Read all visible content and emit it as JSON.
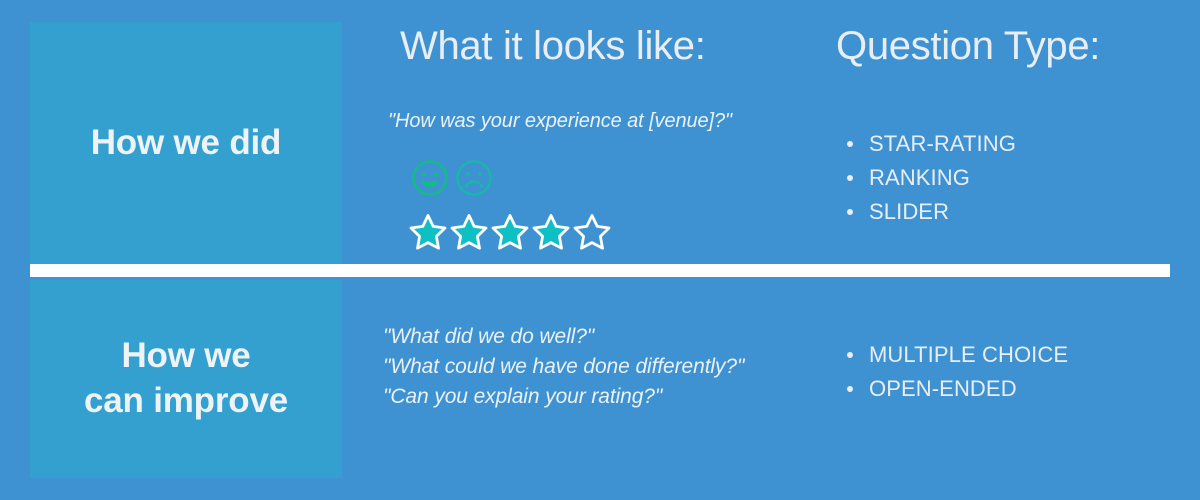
{
  "colors": {
    "background": "#3f92d2",
    "panel": "#33a0cf",
    "divider": "#ffffff",
    "text": "#e8eef4",
    "star_fill": "#0ec0c4",
    "star_outline": "#ffffff",
    "smiley": "#16b98a",
    "frown": "#1ab5ab"
  },
  "columns": {
    "looks_like_header": "What it looks like:",
    "question_type_header": "Question Type:"
  },
  "rows": [
    {
      "label": "How we did",
      "quotes": [
        "\"How was your experience at [venue]?\""
      ],
      "faces": [
        {
          "icon": "smiley-face-icon",
          "expression": "happy"
        },
        {
          "icon": "frowny-face-icon",
          "expression": "sad"
        }
      ],
      "star_rating": {
        "filled": 4,
        "total": 5
      },
      "question_types": [
        "STAR-RATING",
        "RANKING",
        "SLIDER"
      ]
    },
    {
      "label_line1": "How we",
      "label_line2": "can improve",
      "quotes": [
        "\"What did we do well?\"",
        "\"What could we have done differently?\"",
        "\"Can you explain your rating?\""
      ],
      "question_types": [
        "MULTIPLE CHOICE",
        "OPEN-ENDED"
      ]
    }
  ]
}
